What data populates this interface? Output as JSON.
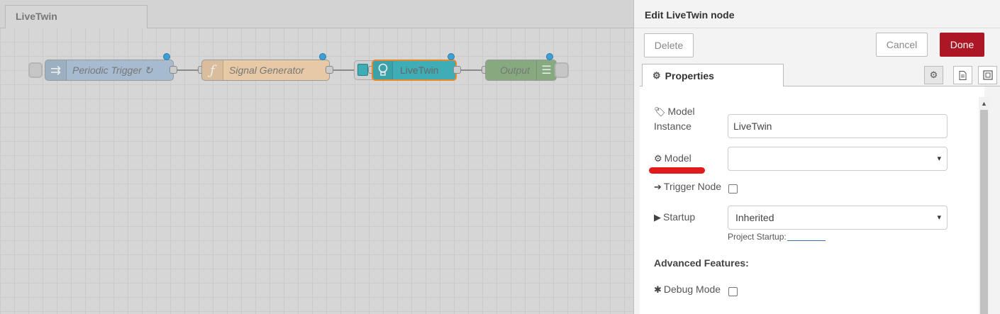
{
  "workspace": {
    "tab_label": "LiveTwin",
    "nodes": {
      "periodic_trigger": {
        "label": "Periodic Trigger ↻",
        "color": "#a6bbcf"
      },
      "signal_generator": {
        "label": "Signal Generator",
        "color": "#e7c9a6"
      },
      "livetwin": {
        "label": "LiveTwin",
        "color": "#3fadb5"
      },
      "output": {
        "label": "Output",
        "color": "#87a980"
      }
    }
  },
  "panel": {
    "title": "Edit LiveTwin node",
    "delete_label": "Delete",
    "cancel_label": "Cancel",
    "done_label": "Done",
    "properties_tab": "Properties",
    "fields": {
      "model_instance_label": "Model Instance",
      "model_instance_value": "LiveTwin",
      "model_label": "Model",
      "model_value": "",
      "trigger_label": "Trigger Node",
      "startup_label": "Startup",
      "startup_value": "Inherited",
      "project_startup_label": "Project Startup:",
      "advanced_label": "Advanced Features:",
      "debug_label": "Debug Mode"
    }
  }
}
